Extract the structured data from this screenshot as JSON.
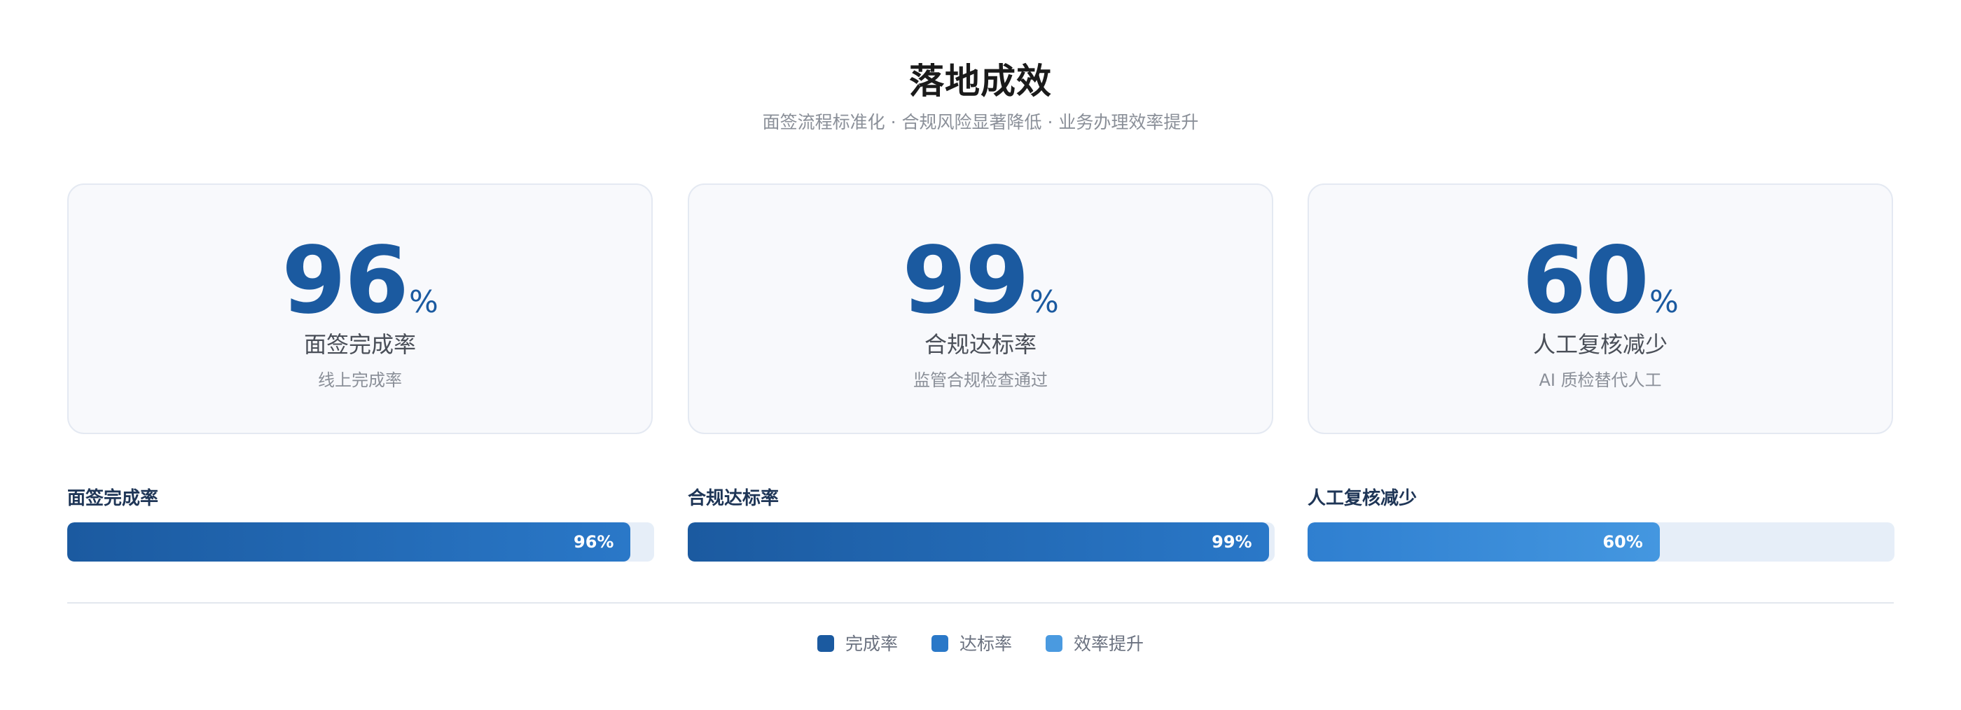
{
  "header": {
    "title": "落地成效",
    "subtitle": "面签流程标准化 · 合规风险显著降低 · 业务办理效率提升"
  },
  "cards": [
    {
      "value": "96",
      "unit": "%",
      "label": "面签完成率",
      "sub": "线上完成率"
    },
    {
      "value": "99",
      "unit": "%",
      "label": "合规达标率",
      "sub": "监管合规检查通过"
    },
    {
      "value": "60",
      "unit": "%",
      "label": "人工复核减少",
      "sub": "AI 质检替代人工"
    }
  ],
  "chart_data": {
    "type": "bar",
    "orientation": "horizontal",
    "categories": [
      "面签完成率",
      "合规达标率",
      "人工复核减少"
    ],
    "values": [
      96,
      99,
      60
    ],
    "value_labels": [
      "96%",
      "99%",
      "60%"
    ],
    "ylim": [
      0,
      100
    ],
    "unit": "%",
    "grid": false,
    "legend_position": "bottom-center",
    "bar_gradients": [
      [
        "#1b5aa0",
        "#2a78c8"
      ],
      [
        "#1b5aa0",
        "#2a78c8"
      ],
      [
        "#2f7fd0",
        "#4497e0"
      ]
    ]
  },
  "legend": [
    {
      "label": "完成率",
      "color": "#1b5aa0"
    },
    {
      "label": "达标率",
      "color": "#2a78c8"
    },
    {
      "label": "效率提升",
      "color": "#4a9ae0"
    }
  ],
  "colors": {
    "accent": "#1b5aa0",
    "track": "#e6eef8",
    "card_bg": "#f8f9fc"
  }
}
